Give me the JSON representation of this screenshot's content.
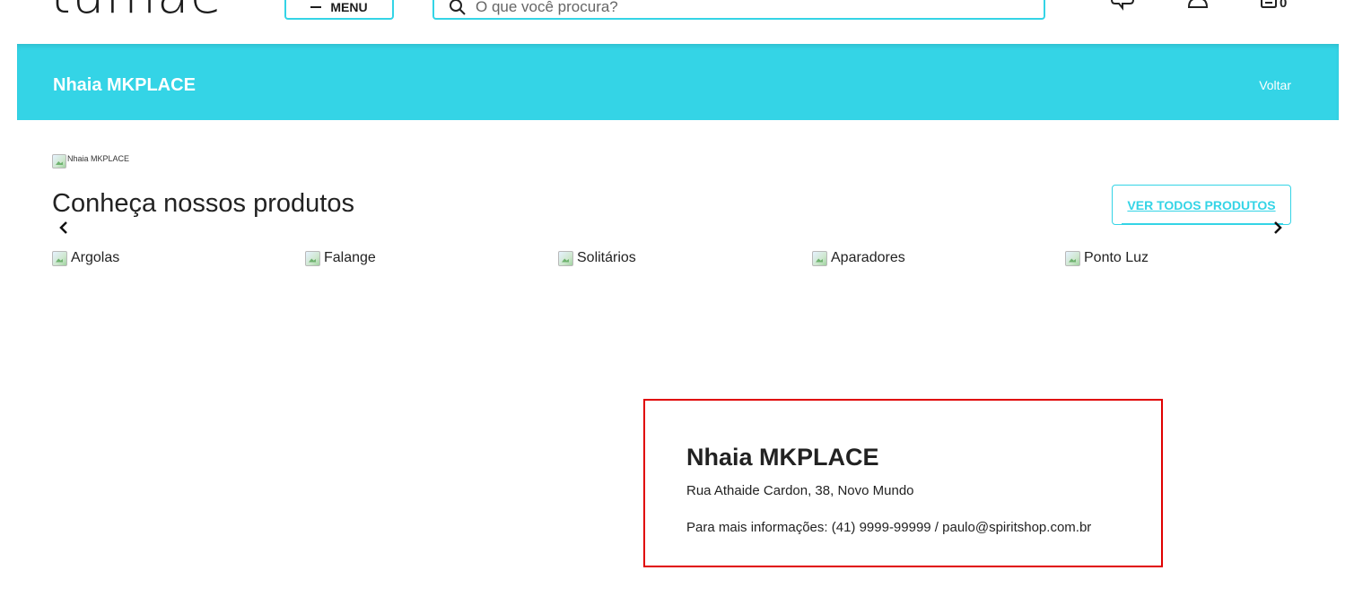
{
  "header": {
    "logo_text": "tumae",
    "menu_label": "MENU",
    "search_placeholder": "O que você procura?",
    "cart_count": "0"
  },
  "banner": {
    "title": "Nhaia MKPLACE",
    "back_label": "Voltar"
  },
  "store_image_alt": "Nhaia MKPLACE",
  "products_section": {
    "title": "Conheça nossos produtos",
    "see_all_label": "VER TODOS PRODUTOS",
    "categories": [
      {
        "label": "Argolas"
      },
      {
        "label": "Falange"
      },
      {
        "label": "Solitários"
      },
      {
        "label": "Aparadores"
      },
      {
        "label": "Ponto Luz"
      }
    ]
  },
  "info_card": {
    "name": "Nhaia MKPLACE",
    "address": "Rua Athaide Cardon, 38, Novo Mundo",
    "contact": "Para mais informações: (41) 9999-99999 / paulo@spiritshop.com.br"
  },
  "colors": {
    "accent": "#34d4e6",
    "highlight_border": "#e00000"
  }
}
